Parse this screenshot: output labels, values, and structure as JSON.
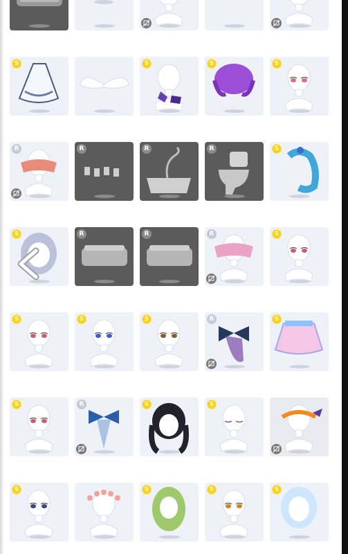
{
  "grid": {
    "items": [
      {
        "badge": "",
        "badge_label": "",
        "style": "dark",
        "art": "sofa-icon",
        "no_preview": false
      },
      {
        "badge": "",
        "badge_label": "",
        "style": "light",
        "art": "outfit-legs-icon",
        "no_preview": false
      },
      {
        "badge": "",
        "badge_label": "",
        "style": "light",
        "art": "mannequin-icon",
        "no_preview": true
      },
      {
        "badge": "",
        "badge_label": "",
        "style": "light",
        "art": "red-skirt-icon",
        "no_preview": false
      },
      {
        "badge": "",
        "badge_label": "",
        "style": "light",
        "art": "mannequin-icon",
        "no_preview": true
      },
      {
        "badge": "s",
        "badge_label": "S",
        "style": "light",
        "art": "white-dress-icon",
        "no_preview": false
      },
      {
        "badge": "",
        "badge_label": "",
        "style": "light",
        "art": "wings-icon",
        "no_preview": false
      },
      {
        "badge": "s",
        "badge_label": "S",
        "style": "light",
        "art": "purple-shoes-icon",
        "no_preview": false
      },
      {
        "badge": "s",
        "badge_label": "S",
        "style": "light",
        "art": "purple-hair-icon",
        "no_preview": false
      },
      {
        "badge": "s",
        "badge_label": "S",
        "style": "light",
        "art": "pink-eyes-icon",
        "no_preview": false
      },
      {
        "badge": "r",
        "badge_label": "R",
        "style": "light",
        "art": "lace-top-icon",
        "no_preview": true
      },
      {
        "badge": "r",
        "badge_label": "R",
        "style": "dark",
        "art": "fence-icon",
        "no_preview": false
      },
      {
        "badge": "r",
        "badge_label": "R",
        "style": "dark",
        "art": "bathtub-icon",
        "no_preview": false
      },
      {
        "badge": "r",
        "badge_label": "R",
        "style": "dark",
        "art": "toilet-icon",
        "no_preview": false
      },
      {
        "badge": "s",
        "badge_label": "S",
        "style": "light",
        "art": "blue-hair-icon",
        "no_preview": false
      },
      {
        "badge": "s",
        "badge_label": "S",
        "style": "light",
        "art": "silver-hair-icon",
        "no_preview": false
      },
      {
        "badge": "r",
        "badge_label": "R",
        "style": "dark",
        "art": "planter-icon",
        "no_preview": false
      },
      {
        "badge": "r",
        "badge_label": "R",
        "style": "dark",
        "art": "planter-icon",
        "no_preview": false
      },
      {
        "badge": "r",
        "badge_label": "R",
        "style": "light",
        "art": "pink-top-icon",
        "no_preview": true
      },
      {
        "badge": "s",
        "badge_label": "S",
        "style": "light",
        "art": "eyes-icon",
        "no_preview": false
      },
      {
        "badge": "s",
        "badge_label": "S",
        "style": "light",
        "art": "eyes-icon",
        "no_preview": false
      },
      {
        "badge": "s",
        "badge_label": "S",
        "style": "light",
        "art": "blue-eyes-icon",
        "no_preview": false
      },
      {
        "badge": "s",
        "badge_label": "S",
        "style": "light",
        "art": "brown-eyes-icon",
        "no_preview": false
      },
      {
        "badge": "r",
        "badge_label": "R",
        "style": "light",
        "art": "bow-icon",
        "no_preview": true
      },
      {
        "badge": "s",
        "badge_label": "S",
        "style": "light",
        "art": "tutu-icon",
        "no_preview": false
      },
      {
        "badge": "s",
        "badge_label": "S",
        "style": "light",
        "art": "eyes-icon",
        "no_preview": false
      },
      {
        "badge": "r",
        "badge_label": "R",
        "style": "light",
        "art": "blue-ribbon-icon",
        "no_preview": true
      },
      {
        "badge": "s",
        "badge_label": "S",
        "style": "light",
        "art": "black-hair-icon",
        "no_preview": false
      },
      {
        "badge": "s",
        "badge_label": "S",
        "style": "light",
        "art": "closed-eyes-icon",
        "no_preview": false
      },
      {
        "badge": "",
        "badge_label": "",
        "style": "gray",
        "art": "bat-headband-icon",
        "no_preview": true
      },
      {
        "badge": "s",
        "badge_label": "S",
        "style": "light",
        "art": "navy-eyes-icon",
        "no_preview": false
      },
      {
        "badge": "",
        "badge_label": "",
        "style": "light",
        "art": "flower-crown-icon",
        "no_preview": false
      },
      {
        "badge": "s",
        "badge_label": "S",
        "style": "light",
        "art": "green-hair-icon",
        "no_preview": false
      },
      {
        "badge": "s",
        "badge_label": "S",
        "style": "light",
        "art": "amber-eyes-icon",
        "no_preview": false
      },
      {
        "badge": "s",
        "badge_label": "S",
        "style": "light",
        "art": "ice-hair-icon",
        "no_preview": false
      }
    ]
  },
  "nav": {
    "back_icon": "chevron-left-icon"
  }
}
